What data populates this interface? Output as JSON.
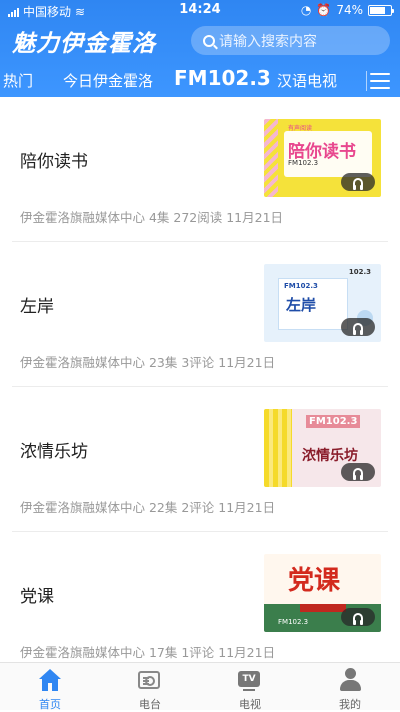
{
  "status_bar": {
    "carrier": "中国移动",
    "time": "14:24",
    "battery_text": "74%",
    "battery_level": 0.74
  },
  "header": {
    "app_title": "魅力伊金霍洛",
    "search_placeholder": "请输入搜索内容",
    "tabs": [
      {
        "label": "热门"
      },
      {
        "label": "今日伊金霍洛"
      },
      {
        "label": "FM102.3"
      },
      {
        "label": "汉语电视"
      }
    ],
    "active_tab": "FM102.3"
  },
  "programs": [
    {
      "title": "陪你读书",
      "meta": "伊金霍洛旗融媒体中心 4集 272阅读 11月21日",
      "thumb": {
        "line1": "陪你读书",
        "line2": "FM102.3",
        "line3": "有声阅读"
      }
    },
    {
      "title": "左岸",
      "meta": "伊金霍洛旗融媒体中心 23集 3评论 11月21日",
      "thumb": {
        "line1": "左岸",
        "line2": "FM102.3",
        "line3": "102.3"
      }
    },
    {
      "title": "浓情乐坊",
      "meta": "伊金霍洛旗融媒体中心 22集 2评论 11月21日",
      "thumb": {
        "line1": "浓情乐坊",
        "line2": "FM102.3"
      }
    },
    {
      "title": "党课",
      "meta": "伊金霍洛旗融媒体中心 17集 1评论 11月21日",
      "thumb": {
        "line1": "党课",
        "line2": "FM102.3"
      }
    }
  ],
  "bottom_nav": [
    {
      "label": "首页",
      "icon": "home-icon",
      "active": true
    },
    {
      "label": "电台",
      "icon": "radio-icon",
      "active": false
    },
    {
      "label": "电视",
      "icon": "tv-icon",
      "active": false,
      "icon_text": "TV"
    },
    {
      "label": "我的",
      "icon": "profile-icon",
      "active": false
    }
  ],
  "colors": {
    "header_blue": "#2f86f2",
    "active_nav": "#2f86f2",
    "meta_gray": "#999999"
  }
}
